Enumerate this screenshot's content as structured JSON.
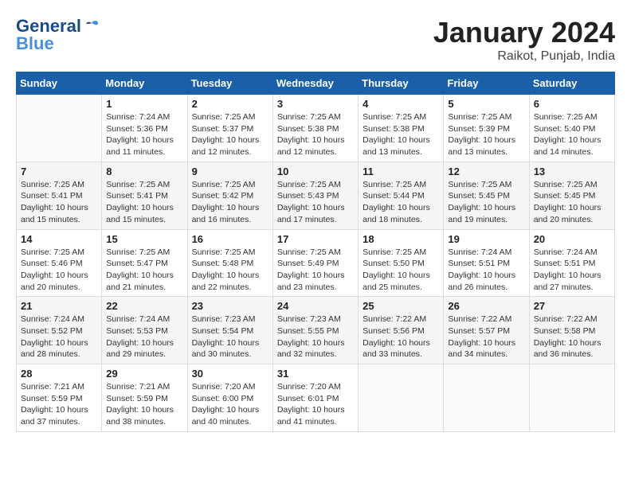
{
  "header": {
    "logo_general": "General",
    "logo_blue": "Blue",
    "month_title": "January 2024",
    "location": "Raikot, Punjab, India"
  },
  "weekdays": [
    "Sunday",
    "Monday",
    "Tuesday",
    "Wednesday",
    "Thursday",
    "Friday",
    "Saturday"
  ],
  "weeks": [
    [
      {
        "day": "",
        "info": ""
      },
      {
        "day": "1",
        "info": "Sunrise: 7:24 AM\nSunset: 5:36 PM\nDaylight: 10 hours\nand 11 minutes."
      },
      {
        "day": "2",
        "info": "Sunrise: 7:25 AM\nSunset: 5:37 PM\nDaylight: 10 hours\nand 12 minutes."
      },
      {
        "day": "3",
        "info": "Sunrise: 7:25 AM\nSunset: 5:38 PM\nDaylight: 10 hours\nand 12 minutes."
      },
      {
        "day": "4",
        "info": "Sunrise: 7:25 AM\nSunset: 5:38 PM\nDaylight: 10 hours\nand 13 minutes."
      },
      {
        "day": "5",
        "info": "Sunrise: 7:25 AM\nSunset: 5:39 PM\nDaylight: 10 hours\nand 13 minutes."
      },
      {
        "day": "6",
        "info": "Sunrise: 7:25 AM\nSunset: 5:40 PM\nDaylight: 10 hours\nand 14 minutes."
      }
    ],
    [
      {
        "day": "7",
        "info": "Sunrise: 7:25 AM\nSunset: 5:41 PM\nDaylight: 10 hours\nand 15 minutes."
      },
      {
        "day": "8",
        "info": "Sunrise: 7:25 AM\nSunset: 5:41 PM\nDaylight: 10 hours\nand 15 minutes."
      },
      {
        "day": "9",
        "info": "Sunrise: 7:25 AM\nSunset: 5:42 PM\nDaylight: 10 hours\nand 16 minutes."
      },
      {
        "day": "10",
        "info": "Sunrise: 7:25 AM\nSunset: 5:43 PM\nDaylight: 10 hours\nand 17 minutes."
      },
      {
        "day": "11",
        "info": "Sunrise: 7:25 AM\nSunset: 5:44 PM\nDaylight: 10 hours\nand 18 minutes."
      },
      {
        "day": "12",
        "info": "Sunrise: 7:25 AM\nSunset: 5:45 PM\nDaylight: 10 hours\nand 19 minutes."
      },
      {
        "day": "13",
        "info": "Sunrise: 7:25 AM\nSunset: 5:45 PM\nDaylight: 10 hours\nand 20 minutes."
      }
    ],
    [
      {
        "day": "14",
        "info": "Sunrise: 7:25 AM\nSunset: 5:46 PM\nDaylight: 10 hours\nand 20 minutes."
      },
      {
        "day": "15",
        "info": "Sunrise: 7:25 AM\nSunset: 5:47 PM\nDaylight: 10 hours\nand 21 minutes."
      },
      {
        "day": "16",
        "info": "Sunrise: 7:25 AM\nSunset: 5:48 PM\nDaylight: 10 hours\nand 22 minutes."
      },
      {
        "day": "17",
        "info": "Sunrise: 7:25 AM\nSunset: 5:49 PM\nDaylight: 10 hours\nand 23 minutes."
      },
      {
        "day": "18",
        "info": "Sunrise: 7:25 AM\nSunset: 5:50 PM\nDaylight: 10 hours\nand 25 minutes."
      },
      {
        "day": "19",
        "info": "Sunrise: 7:24 AM\nSunset: 5:51 PM\nDaylight: 10 hours\nand 26 minutes."
      },
      {
        "day": "20",
        "info": "Sunrise: 7:24 AM\nSunset: 5:51 PM\nDaylight: 10 hours\nand 27 minutes."
      }
    ],
    [
      {
        "day": "21",
        "info": "Sunrise: 7:24 AM\nSunset: 5:52 PM\nDaylight: 10 hours\nand 28 minutes."
      },
      {
        "day": "22",
        "info": "Sunrise: 7:24 AM\nSunset: 5:53 PM\nDaylight: 10 hours\nand 29 minutes."
      },
      {
        "day": "23",
        "info": "Sunrise: 7:23 AM\nSunset: 5:54 PM\nDaylight: 10 hours\nand 30 minutes."
      },
      {
        "day": "24",
        "info": "Sunrise: 7:23 AM\nSunset: 5:55 PM\nDaylight: 10 hours\nand 32 minutes."
      },
      {
        "day": "25",
        "info": "Sunrise: 7:22 AM\nSunset: 5:56 PM\nDaylight: 10 hours\nand 33 minutes."
      },
      {
        "day": "26",
        "info": "Sunrise: 7:22 AM\nSunset: 5:57 PM\nDaylight: 10 hours\nand 34 minutes."
      },
      {
        "day": "27",
        "info": "Sunrise: 7:22 AM\nSunset: 5:58 PM\nDaylight: 10 hours\nand 36 minutes."
      }
    ],
    [
      {
        "day": "28",
        "info": "Sunrise: 7:21 AM\nSunset: 5:59 PM\nDaylight: 10 hours\nand 37 minutes."
      },
      {
        "day": "29",
        "info": "Sunrise: 7:21 AM\nSunset: 5:59 PM\nDaylight: 10 hours\nand 38 minutes."
      },
      {
        "day": "30",
        "info": "Sunrise: 7:20 AM\nSunset: 6:00 PM\nDaylight: 10 hours\nand 40 minutes."
      },
      {
        "day": "31",
        "info": "Sunrise: 7:20 AM\nSunset: 6:01 PM\nDaylight: 10 hours\nand 41 minutes."
      },
      {
        "day": "",
        "info": ""
      },
      {
        "day": "",
        "info": ""
      },
      {
        "day": "",
        "info": ""
      }
    ]
  ]
}
